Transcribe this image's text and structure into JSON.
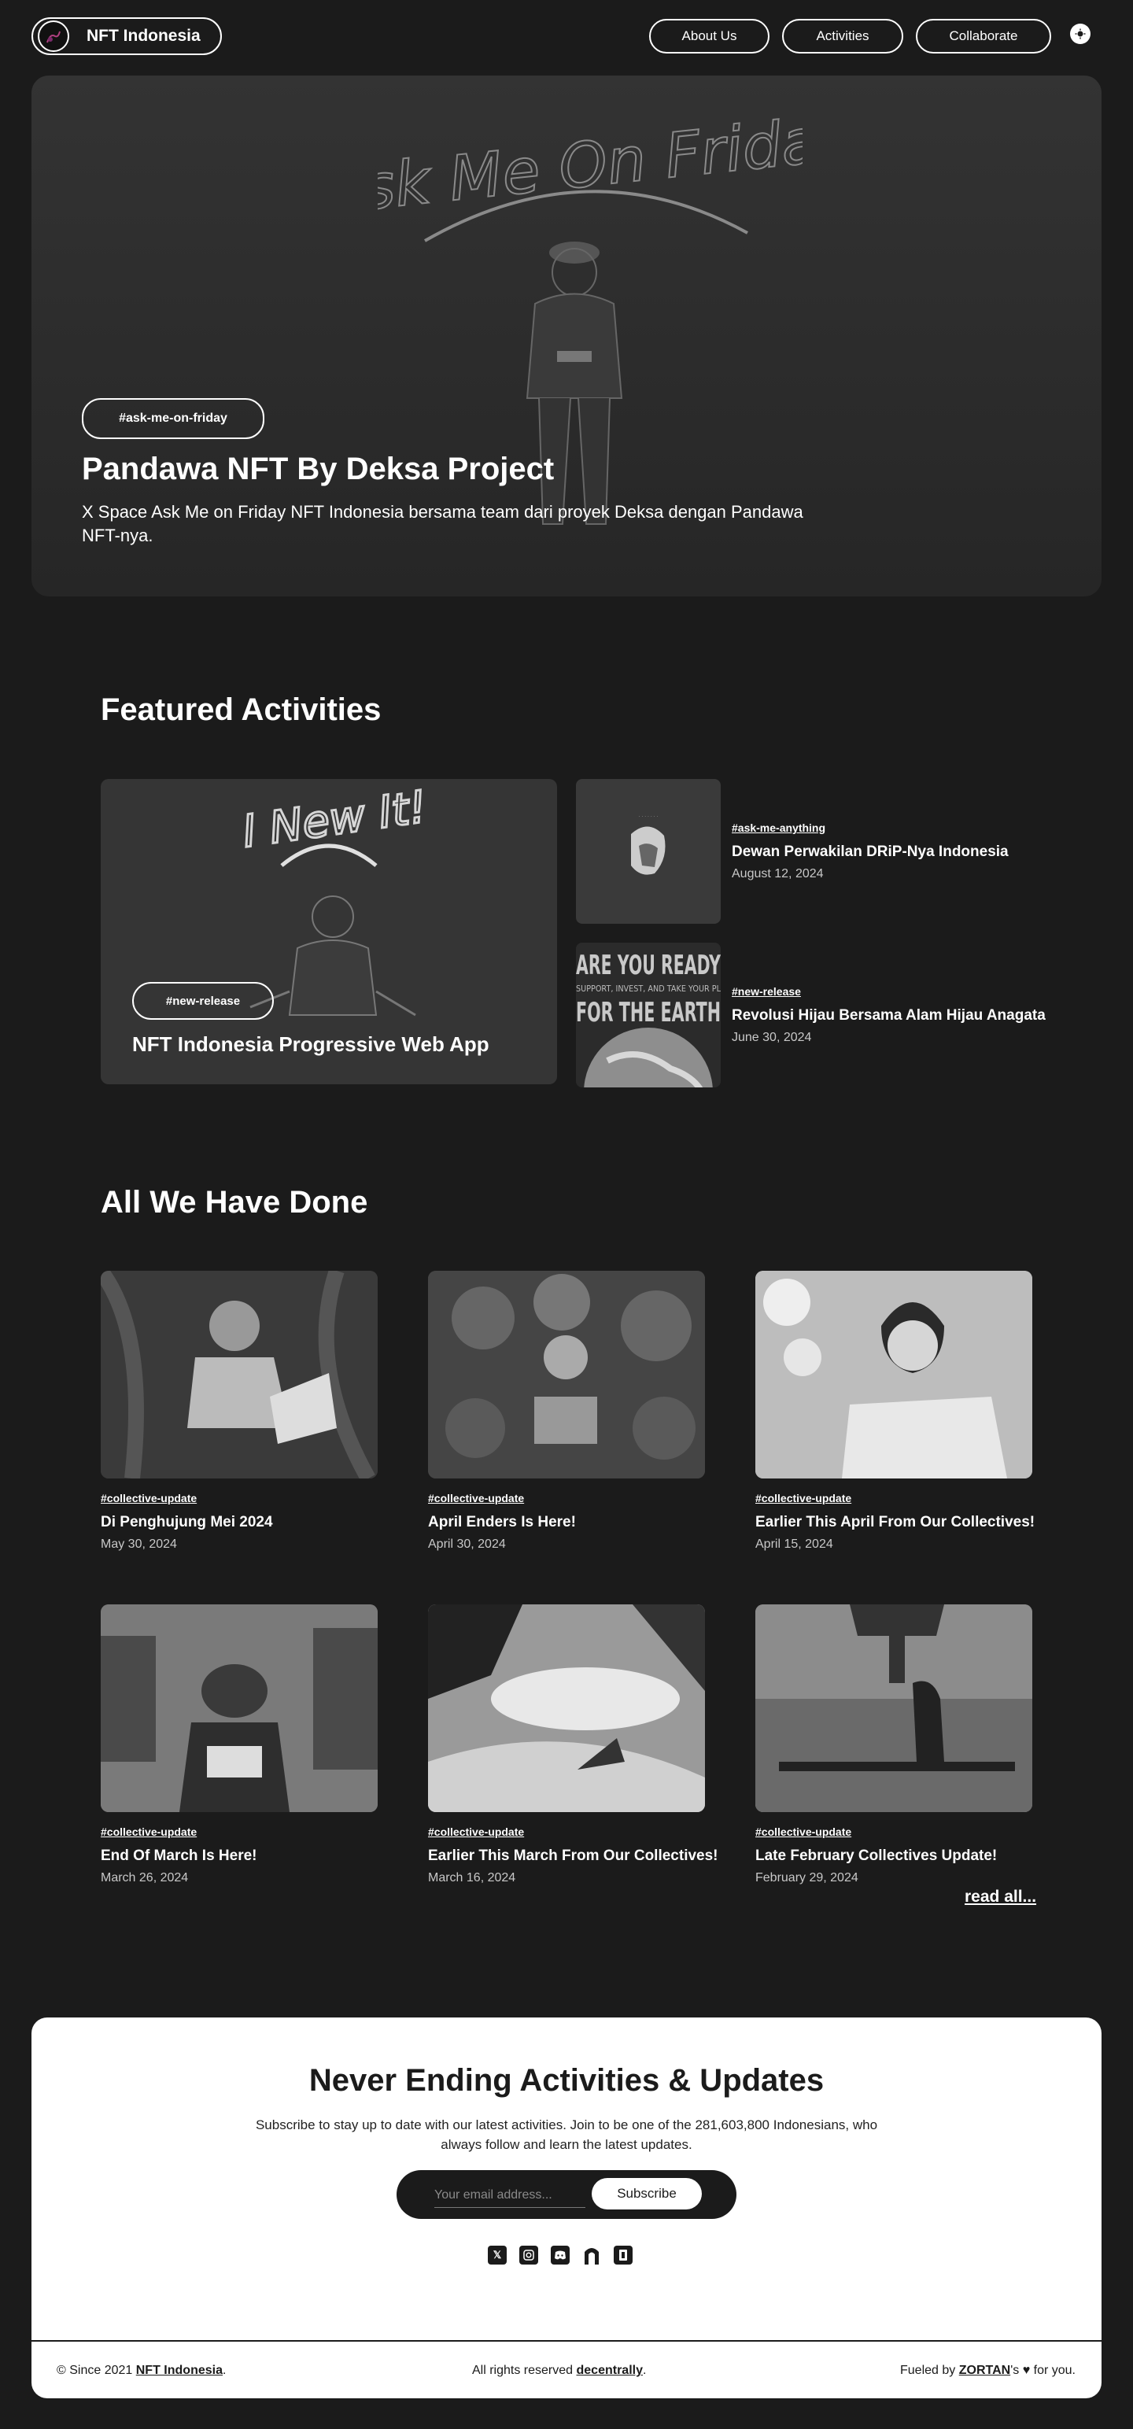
{
  "header": {
    "brand": "NFT Indonesia",
    "nav": [
      "About Us",
      "Activities",
      "Collaborate"
    ]
  },
  "hero": {
    "tag": "#ask-me-on-friday",
    "title": "Pandawa NFT By Deksa Project",
    "description": "X Space Ask Me on Friday NFT Indonesia bersama team dari proyek Deksa dengan Pandawa NFT-nya.",
    "art_text": "Ask Me On Friday"
  },
  "featured": {
    "heading": "Featured Activities",
    "main": {
      "tag": "#new-release",
      "title": "NFT Indonesia Progressive Web App",
      "art_text": "I New It!"
    },
    "items": [
      {
        "tag": "#ask-me-anything",
        "title": "Dewan Perwakilan DRiP-Nya Indonesia",
        "date": "August 12, 2024"
      },
      {
        "tag": "#new-release",
        "title": "Revolusi Hijau Bersama Alam Hijau Anagata",
        "date": "June 30, 2024",
        "art_line1": "ARE YOU READY",
        "art_line2": "SUPPORT, INVEST, AND TAKE YOUR PL",
        "art_line3": "FOR THE EARTH"
      }
    ]
  },
  "done": {
    "heading": "All We Have Done",
    "cards": [
      {
        "tag": "#collective-update",
        "title": "Di Penghujung Mei 2024",
        "date": "May 30, 2024"
      },
      {
        "tag": "#collective-update",
        "title": "April Enders Is Here!",
        "date": "April 30, 2024"
      },
      {
        "tag": "#collective-update",
        "title": "Earlier This April From Our Collectives!",
        "date": "April 15, 2024"
      },
      {
        "tag": "#collective-update",
        "title": "End Of March Is Here!",
        "date": "March 26, 2024"
      },
      {
        "tag": "#collective-update",
        "title": "Earlier This March From Our Collectives!",
        "date": "March 16, 2024"
      },
      {
        "tag": "#collective-update",
        "title": "Late February Collectives Update!",
        "date": "February 29, 2024"
      }
    ],
    "read_all": "read all..."
  },
  "subscribe": {
    "title": "Never Ending Activities & Updates",
    "description": "Subscribe to stay up to date with our latest activities. Join to be one of the 281,603,800 Indonesians, who always follow and learn the latest updates.",
    "placeholder": "Your email address...",
    "button": "Subscribe",
    "socials": [
      "x-icon",
      "instagram-icon",
      "discord-icon",
      "arch-icon",
      "drip-icon"
    ]
  },
  "footer": {
    "since_prefix": "© Since 2021 ",
    "since_link": "NFT Indonesia",
    "since_suffix": ".",
    "rights_prefix": "All rights reserved ",
    "rights_link": "decentrally",
    "rights_suffix": ".",
    "fuel_prefix": "Fueled by ",
    "fuel_link": "ZORTAN",
    "fuel_suffix": "'s ♥ for you."
  }
}
